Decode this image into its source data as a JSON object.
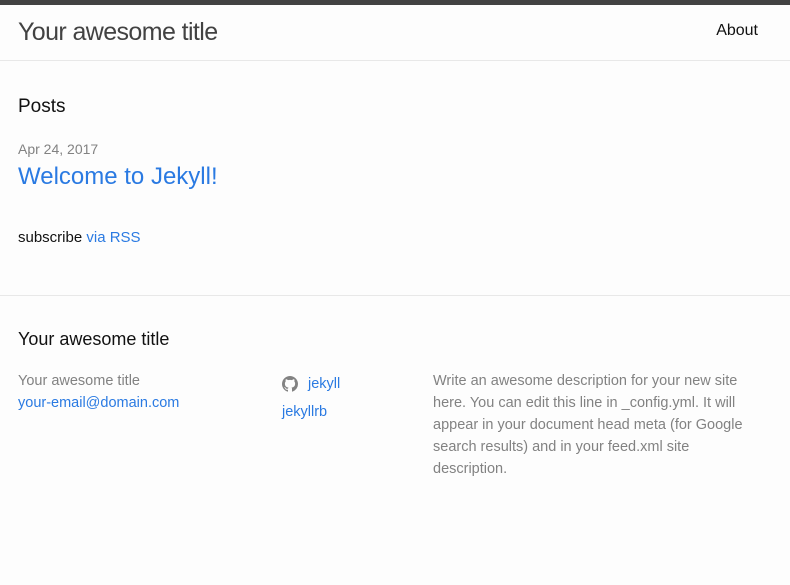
{
  "header": {
    "site_title": "Your awesome title",
    "nav": [
      {
        "label": "About"
      }
    ]
  },
  "main": {
    "heading": "Posts",
    "posts": [
      {
        "date": "Apr 24, 2017",
        "title": "Welcome to Jekyll!"
      }
    ],
    "subscribe_prefix": "subscribe",
    "subscribe_link": "via RSS"
  },
  "footer": {
    "heading": "Your awesome title",
    "name": "Your awesome title",
    "email": "your-email@domain.com",
    "github_icon": "github-icon",
    "github_user": "jekyll",
    "twitter_user": "jekyllrb",
    "description": "Write an awesome description for your new site here. You can edit this line in _config.yml. It will appear in your document head meta (for Google search results) and in your feed.xml site description."
  },
  "colors": {
    "link": "#2a7ae2",
    "text": "#111111",
    "muted": "#828282",
    "topbar": "#424242"
  }
}
